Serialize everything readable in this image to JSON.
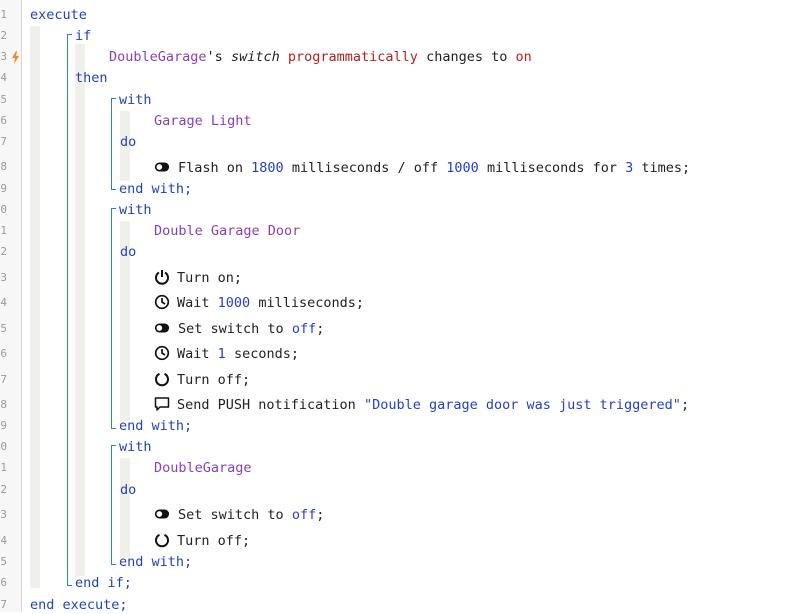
{
  "line_numbers": [
    "1",
    "2",
    "3",
    "4",
    "5",
    "6",
    "7",
    "8",
    "9",
    "0",
    "1",
    "2",
    "3",
    "4",
    "5",
    "6",
    "7",
    "8",
    "9",
    "0",
    "1",
    "2",
    "3",
    "4",
    "5",
    "6",
    "7"
  ],
  "colors": {
    "keyword": "#1f44b8",
    "device": "#8a3fb8",
    "trigger": "#b22222",
    "number": "#2540c7",
    "guide": "#2d7fd0",
    "band": "#f0efe9",
    "marker": "#f08a24"
  },
  "code": {
    "execute": "execute",
    "if": "if",
    "condition": {
      "device": "DoubleGarage",
      "possessive": "'s",
      "attribute": "switch",
      "mode": "programmatically",
      "verb": "changes to",
      "value": "on"
    },
    "then": "then",
    "with1": {
      "with_kw": "with",
      "device": "Garage Light",
      "do_kw": "do",
      "cmd": {
        "icon": "toggle-icon",
        "text1": "Flash on",
        "num1": "1800",
        "text2": "milliseconds / off",
        "num2": "1000",
        "text3": "milliseconds for",
        "num3": "3",
        "text4": "times;"
      },
      "end_kw": "end with;"
    },
    "with2": {
      "with_kw": "with",
      "device": "Double Garage Door",
      "do_kw": "do",
      "cmd1": {
        "icon": "power-icon",
        "text": "Turn on;"
      },
      "cmd2": {
        "icon": "clock-icon",
        "text1": "Wait",
        "num": "1000",
        "text2": "milliseconds;"
      },
      "cmd3": {
        "icon": "toggle-icon",
        "text1": "Set switch to",
        "val": "off",
        "text2": ";"
      },
      "cmd4": {
        "icon": "clock-icon",
        "text1": "Wait",
        "num": "1",
        "text2": "seconds;"
      },
      "cmd5": {
        "icon": "power-off-icon",
        "text": "Turn off;"
      },
      "cmd6": {
        "icon": "message-icon",
        "text1": "Send PUSH notification",
        "str": "\"Double garage door was just triggered\"",
        "text2": ";"
      },
      "end_kw": "end with;"
    },
    "with3": {
      "with_kw": "with",
      "device": "DoubleGarage",
      "do_kw": "do",
      "cmd1": {
        "icon": "toggle-icon",
        "text1": "Set switch to",
        "val": "off",
        "text2": ";"
      },
      "cmd2": {
        "icon": "power-off-icon",
        "text": "Turn off;"
      },
      "end_kw": "end with;"
    },
    "end_if": "end if;",
    "end_execute": "end execute;"
  }
}
